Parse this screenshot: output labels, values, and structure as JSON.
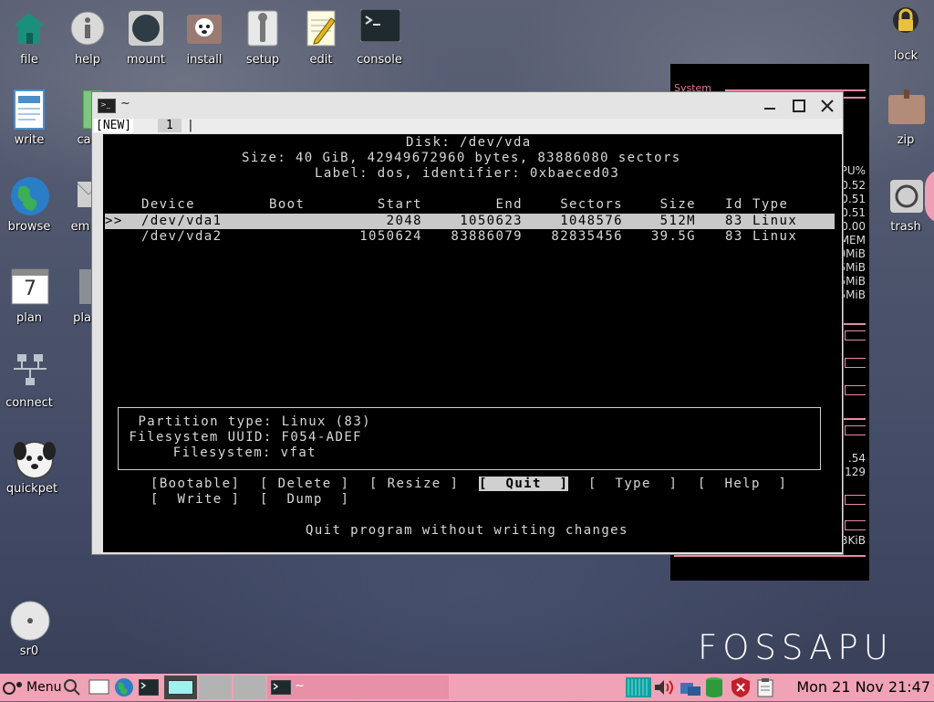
{
  "desktop_icons": [
    {
      "label": "file",
      "icon": "house-icon"
    },
    {
      "label": "help",
      "icon": "info-icon"
    },
    {
      "label": "mount",
      "icon": "disk-icon"
    },
    {
      "label": "install",
      "icon": "puppy-box-icon"
    },
    {
      "label": "setup",
      "icon": "wrench-icon"
    },
    {
      "label": "edit",
      "icon": "notepad-pencil-icon"
    },
    {
      "label": "console",
      "icon": "terminal-icon"
    },
    {
      "label": "lock",
      "icon": "padlock-icon"
    },
    {
      "label": "write",
      "icon": "document-icon"
    },
    {
      "label": "ca",
      "icon": "spreadsheet-icon"
    },
    {
      "label": "zip",
      "icon": "bag-icon"
    },
    {
      "label": "browse",
      "icon": "globe-icon"
    },
    {
      "label": "em",
      "icon": "mail-icon"
    },
    {
      "label": "trash",
      "icon": "trash-icon"
    },
    {
      "label": "plan",
      "icon": "calendar-icon"
    },
    {
      "label": "pla",
      "icon": "film-icon"
    },
    {
      "label": "connect",
      "icon": "network-icon"
    },
    {
      "label": "quickpet",
      "icon": "puppy-face-icon"
    },
    {
      "label": "sr0",
      "icon": "cd-icon"
    }
  ],
  "calendar_day": "7",
  "conky": {
    "title": "System",
    "values": [
      "PU%",
      "0.52",
      "0.51",
      "0.51",
      "0.00",
      "MEM",
      "0MiB",
      "5MiB",
      "5MiB",
      "5MiB",
      ".54",
      "129",
      "3KiB"
    ]
  },
  "window": {
    "title": "~",
    "tabs": [
      "[NEW]",
      "1"
    ],
    "terminal": {
      "header": {
        "disk": "Disk: /dev/vda",
        "size": "Size: 40 GiB, 42949672960 bytes, 83886080 sectors",
        "label": "Label: dos, identifier: 0xbaeced03"
      },
      "columns": {
        "device": "Device",
        "boot": "Boot",
        "start": "Start",
        "end": "End",
        "sectors": "Sectors",
        "size": "Size",
        "id": "Id",
        "type": "Type"
      },
      "rows": [
        {
          "marker": ">>",
          "device": "/dev/vda1",
          "boot": "",
          "start": "2048",
          "end": "1050623",
          "sectors": "1048576",
          "size": "512M",
          "id": "83",
          "type": "Linux"
        },
        {
          "marker": "",
          "device": "/dev/vda2",
          "boot": "",
          "start": "1050624",
          "end": "83886079",
          "sectors": "82835456",
          "size": "39.5G",
          "id": "83",
          "type": "Linux"
        }
      ],
      "info": {
        "partition_type": "Partition type: Linux (83)",
        "fs_uuid": "Filesystem UUID: F054-ADEF",
        "filesystem": "Filesystem: vfat"
      },
      "menu": [
        "[Bootable]",
        "[ Delete ]",
        "[ Resize ]",
        "[  Quit  ]",
        "[  Type  ]",
        "[  Help  ]",
        "[  Write ]",
        "[  Dump  ]"
      ],
      "status": "Quit program without writing changes"
    }
  },
  "logo_text": "FOSSAPU",
  "taskbar": {
    "menu_label": "Menu",
    "task_title": "~",
    "clock": "Mon 21 Nov 21:47"
  },
  "colors": {
    "taskbar": "#f0a3b6",
    "terminal_bg": "#000000",
    "selected_row": "#c9c9c9",
    "conky_accent": "#e98aa6"
  }
}
